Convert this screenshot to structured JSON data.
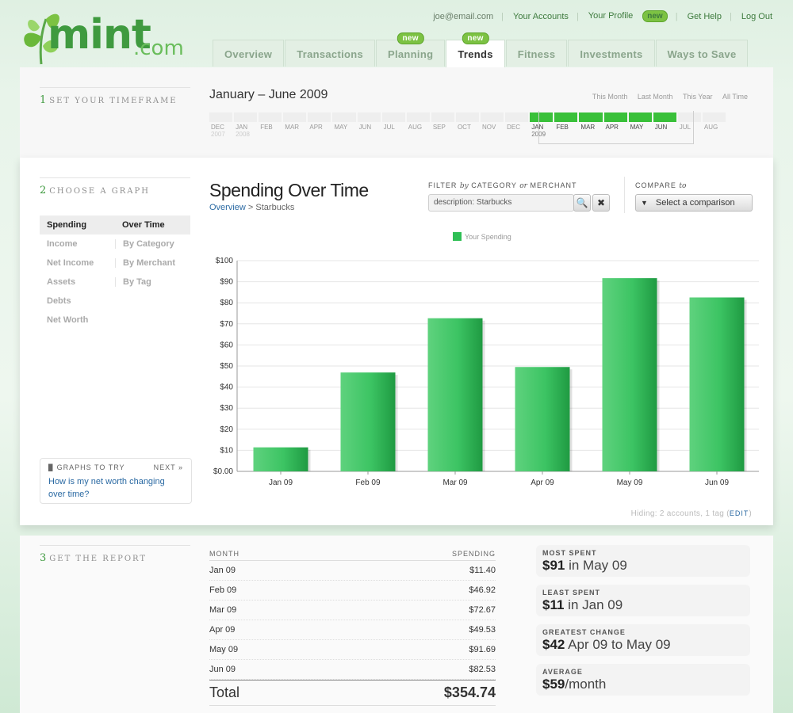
{
  "header": {
    "logo": "mint.com",
    "logo_word": "mint",
    "logo_suffix": ".com",
    "email": "joe@email.com",
    "links": {
      "accounts": "Your Accounts",
      "profile": "Your Profile",
      "profile_badge": "new",
      "help": "Get Help",
      "logout": "Log Out"
    },
    "tabs": [
      {
        "label": "Overview",
        "badge": ""
      },
      {
        "label": "Transactions",
        "badge": ""
      },
      {
        "label": "Planning",
        "badge": "new"
      },
      {
        "label": "Trends",
        "badge": "new",
        "active": true
      },
      {
        "label": "Fitness",
        "badge": ""
      },
      {
        "label": "Investments",
        "badge": ""
      },
      {
        "label": "Ways to Save",
        "badge": ""
      }
    ]
  },
  "timeframe": {
    "step_num": "1",
    "step_label": "SET YOUR TIMEFRAME",
    "title": "January – June 2009",
    "quick_links": [
      "This Month",
      "Last Month",
      "This Year",
      "All Time"
    ],
    "months": [
      {
        "m": "DEC",
        "y": "2007",
        "sel": false
      },
      {
        "m": "JAN",
        "y": "2008",
        "sel": false
      },
      {
        "m": "FEB",
        "y": "",
        "sel": false
      },
      {
        "m": "MAR",
        "y": "",
        "sel": false
      },
      {
        "m": "APR",
        "y": "",
        "sel": false
      },
      {
        "m": "MAY",
        "y": "",
        "sel": false
      },
      {
        "m": "JUN",
        "y": "",
        "sel": false
      },
      {
        "m": "JUL",
        "y": "",
        "sel": false
      },
      {
        "m": "AUG",
        "y": "",
        "sel": false
      },
      {
        "m": "SEP",
        "y": "",
        "sel": false
      },
      {
        "m": "OCT",
        "y": "",
        "sel": false
      },
      {
        "m": "NOV",
        "y": "",
        "sel": false
      },
      {
        "m": "DEC",
        "y": "",
        "sel": false
      },
      {
        "m": "JAN",
        "y": "2009",
        "sel": true
      },
      {
        "m": "FEB",
        "y": "",
        "sel": true
      },
      {
        "m": "MAR",
        "y": "",
        "sel": true
      },
      {
        "m": "APR",
        "y": "",
        "sel": true
      },
      {
        "m": "MAY",
        "y": "",
        "sel": true
      },
      {
        "m": "JUN",
        "y": "",
        "sel": true
      },
      {
        "m": "JUL",
        "y": "",
        "sel": false
      },
      {
        "m": "AUG",
        "y": "",
        "sel": false
      }
    ]
  },
  "graph": {
    "step_num": "2",
    "step_label": "CHOOSE A GRAPH",
    "types_col1": [
      "Spending",
      "Income",
      "Net Income",
      "Assets",
      "Debts",
      "Net Worth"
    ],
    "types_col2": [
      "Over Time",
      "By Category",
      "By Merchant",
      "By Tag"
    ],
    "tip_header": "GRAPHS TO TRY",
    "tip_next": "NEXT »",
    "tip_question": "How is my net worth changing over time?",
    "title": "Spending Over Time",
    "crumb_link": "Overview",
    "crumb_sep": ">",
    "crumb_current": "Starbucks",
    "filter_label_a": "FILTER",
    "filter_label_by": "by",
    "filter_label_b": "CATEGORY",
    "filter_label_or": "or",
    "filter_label_c": "MERCHANT",
    "filter_value": "description: Starbucks",
    "compare_label": "COMPARE",
    "compare_to": "to",
    "compare_button": "Select a comparison",
    "hiding_text": "Hiding: 2 accounts, 1 tag (",
    "hiding_edit": "EDIT",
    "hiding_close": ")"
  },
  "chart_data": {
    "type": "bar",
    "categories": [
      "Jan 09",
      "Feb 09",
      "Mar 09",
      "Apr 09",
      "May 09",
      "Jun 09"
    ],
    "series": [
      {
        "name": "Your Spending",
        "values": [
          11.4,
          46.92,
          72.67,
          49.53,
          91.69,
          82.53
        ],
        "color": "#2fbf55"
      }
    ],
    "yticks": [
      "$0.00",
      "$10",
      "$20",
      "$30",
      "$40",
      "$50",
      "$60",
      "$70",
      "$80",
      "$90",
      "$100"
    ],
    "ylim": [
      0,
      100
    ],
    "legend": "top-center",
    "grid": true
  },
  "report": {
    "step_num": "3",
    "step_label": "GET THE REPORT",
    "col_month": "MONTH",
    "col_spending": "SPENDING",
    "rows": [
      {
        "month": "Jan 09",
        "amount": "$11.40"
      },
      {
        "month": "Feb 09",
        "amount": "$46.92"
      },
      {
        "month": "Mar 09",
        "amount": "$72.67"
      },
      {
        "month": "Apr 09",
        "amount": "$49.53"
      },
      {
        "month": "May 09",
        "amount": "$91.69"
      },
      {
        "month": "Jun 09",
        "amount": "$82.53"
      }
    ],
    "total_label": "Total",
    "total_value": "$354.74",
    "stats": [
      {
        "key": "MOST SPENT",
        "big": "$91",
        "rest": " in May 09"
      },
      {
        "key": "LEAST SPENT",
        "big": "$11",
        "rest": " in Jan 09"
      },
      {
        "key": "GREATEST CHANGE",
        "big": "$42",
        "rest": " Apr 09 to May 09"
      },
      {
        "key": "AVERAGE",
        "big": "$59",
        "rest": "/month"
      }
    ]
  }
}
